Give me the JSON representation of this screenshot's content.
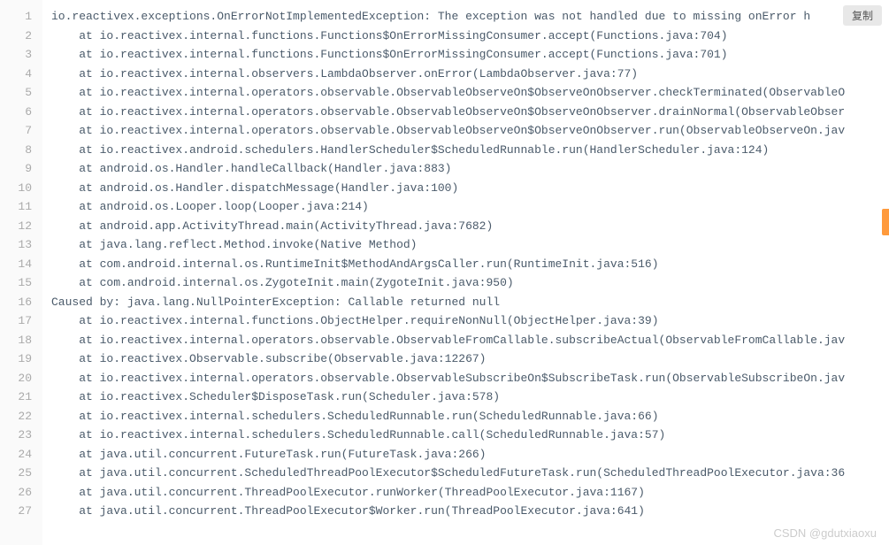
{
  "copy_label": "复制",
  "watermark": "CSDN @gdutxiaoxu",
  "lines": [
    "io.reactivex.exceptions.OnErrorNotImplementedException: The exception was not handled due to missing onError h",
    "    at io.reactivex.internal.functions.Functions$OnErrorMissingConsumer.accept(Functions.java:704)",
    "    at io.reactivex.internal.functions.Functions$OnErrorMissingConsumer.accept(Functions.java:701)",
    "    at io.reactivex.internal.observers.LambdaObserver.onError(LambdaObserver.java:77)",
    "    at io.reactivex.internal.operators.observable.ObservableObserveOn$ObserveOnObserver.checkTerminated(ObservableO",
    "    at io.reactivex.internal.operators.observable.ObservableObserveOn$ObserveOnObserver.drainNormal(ObservableObser",
    "    at io.reactivex.internal.operators.observable.ObservableObserveOn$ObserveOnObserver.run(ObservableObserveOn.jav",
    "    at io.reactivex.android.schedulers.HandlerScheduler$ScheduledRunnable.run(HandlerScheduler.java:124)",
    "    at android.os.Handler.handleCallback(Handler.java:883)",
    "    at android.os.Handler.dispatchMessage(Handler.java:100)",
    "    at android.os.Looper.loop(Looper.java:214)",
    "    at android.app.ActivityThread.main(ActivityThread.java:7682)",
    "    at java.lang.reflect.Method.invoke(Native Method)",
    "    at com.android.internal.os.RuntimeInit$MethodAndArgsCaller.run(RuntimeInit.java:516)",
    "    at com.android.internal.os.ZygoteInit.main(ZygoteInit.java:950)",
    "Caused by: java.lang.NullPointerException: Callable returned null",
    "    at io.reactivex.internal.functions.ObjectHelper.requireNonNull(ObjectHelper.java:39)",
    "    at io.reactivex.internal.operators.observable.ObservableFromCallable.subscribeActual(ObservableFromCallable.jav",
    "    at io.reactivex.Observable.subscribe(Observable.java:12267)",
    "    at io.reactivex.internal.operators.observable.ObservableSubscribeOn$SubscribeTask.run(ObservableSubscribeOn.jav",
    "    at io.reactivex.Scheduler$DisposeTask.run(Scheduler.java:578)",
    "    at io.reactivex.internal.schedulers.ScheduledRunnable.run(ScheduledRunnable.java:66)",
    "    at io.reactivex.internal.schedulers.ScheduledRunnable.call(ScheduledRunnable.java:57)",
    "    at java.util.concurrent.FutureTask.run(FutureTask.java:266)",
    "    at java.util.concurrent.ScheduledThreadPoolExecutor$ScheduledFutureTask.run(ScheduledThreadPoolExecutor.java:36",
    "    at java.util.concurrent.ThreadPoolExecutor.runWorker(ThreadPoolExecutor.java:1167)",
    "    at java.util.concurrent.ThreadPoolExecutor$Worker.run(ThreadPoolExecutor.java:641)"
  ]
}
